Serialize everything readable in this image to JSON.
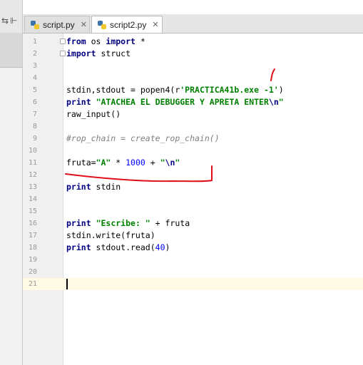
{
  "tabs": [
    {
      "label": "script.py",
      "active": false
    },
    {
      "label": "script2.py",
      "active": true
    }
  ],
  "tab_close_glyph": "✕",
  "left_strip_icons": [
    "⇆",
    "⊩"
  ],
  "current_line": 21,
  "lines": [
    {
      "n": 1,
      "tokens": [
        {
          "t": "kw",
          "v": "from"
        },
        {
          "t": "p",
          "v": " os "
        },
        {
          "t": "kw",
          "v": "import"
        },
        {
          "t": "p",
          "v": " *"
        }
      ]
    },
    {
      "n": 2,
      "tokens": [
        {
          "t": "kw",
          "v": "import"
        },
        {
          "t": "p",
          "v": " struct"
        }
      ]
    },
    {
      "n": 3,
      "tokens": []
    },
    {
      "n": 4,
      "tokens": []
    },
    {
      "n": 5,
      "tokens": [
        {
          "t": "p",
          "v": "stdin,stdout = popen4(r"
        },
        {
          "t": "st",
          "v": "'PRACTICA41b.exe -1'"
        },
        {
          "t": "p",
          "v": ")"
        }
      ]
    },
    {
      "n": 6,
      "tokens": [
        {
          "t": "kw",
          "v": "print"
        },
        {
          "t": "p",
          "v": " "
        },
        {
          "t": "st",
          "v": "\"ATACHEA EL DEBUGGER Y APRETA ENTER"
        },
        {
          "t": "kw",
          "v": "\\n"
        },
        {
          "t": "st",
          "v": "\""
        }
      ]
    },
    {
      "n": 7,
      "tokens": [
        {
          "t": "p",
          "v": "raw_input()"
        }
      ]
    },
    {
      "n": 8,
      "tokens": []
    },
    {
      "n": 9,
      "tokens": [
        {
          "t": "cm",
          "v": "#rop_chain = create_rop_chain()"
        }
      ]
    },
    {
      "n": 10,
      "tokens": []
    },
    {
      "n": 11,
      "tokens": [
        {
          "t": "p",
          "v": "fruta="
        },
        {
          "t": "st",
          "v": "\"A\""
        },
        {
          "t": "p",
          "v": " * "
        },
        {
          "t": "nm",
          "v": "1000"
        },
        {
          "t": "p",
          "v": " + "
        },
        {
          "t": "st",
          "v": "\""
        },
        {
          "t": "kw",
          "v": "\\n"
        },
        {
          "t": "st",
          "v": "\""
        }
      ]
    },
    {
      "n": 12,
      "tokens": []
    },
    {
      "n": 13,
      "tokens": [
        {
          "t": "kw",
          "v": "print"
        },
        {
          "t": "p",
          "v": " stdin"
        }
      ]
    },
    {
      "n": 14,
      "tokens": []
    },
    {
      "n": 15,
      "tokens": []
    },
    {
      "n": 16,
      "tokens": [
        {
          "t": "kw",
          "v": "print"
        },
        {
          "t": "p",
          "v": " "
        },
        {
          "t": "st",
          "v": "\"Escribe: \""
        },
        {
          "t": "p",
          "v": " + fruta"
        }
      ]
    },
    {
      "n": 17,
      "tokens": [
        {
          "t": "p",
          "v": "stdin.write(fruta)"
        }
      ]
    },
    {
      "n": 18,
      "tokens": [
        {
          "t": "kw",
          "v": "print"
        },
        {
          "t": "p",
          "v": " stdout.read("
        },
        {
          "t": "nm",
          "v": "40"
        },
        {
          "t": "p",
          "v": ")"
        }
      ]
    },
    {
      "n": 19,
      "tokens": []
    },
    {
      "n": 20,
      "tokens": []
    },
    {
      "n": 21,
      "tokens": []
    }
  ],
  "colors": {
    "annotation": "#e0101a",
    "keyword": "#000080",
    "string": "#008000",
    "number": "#0000ff",
    "comment": "#808080"
  }
}
